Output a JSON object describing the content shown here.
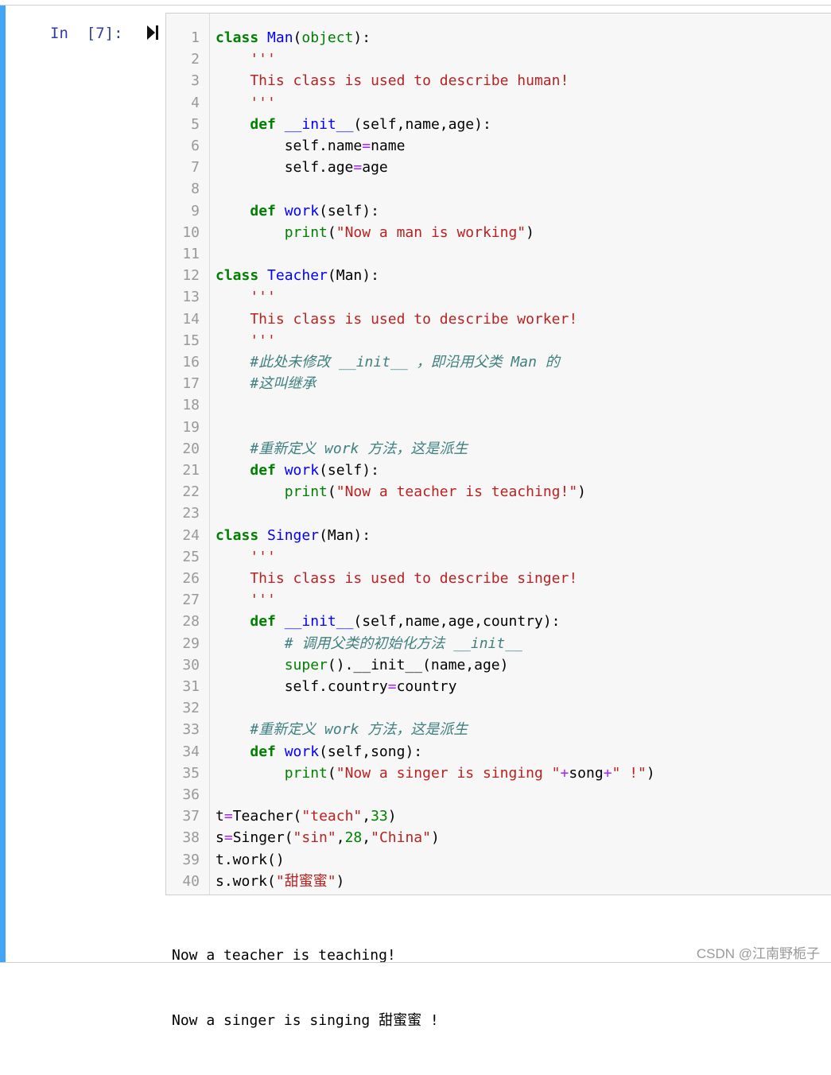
{
  "cell": {
    "prompt": "In  [7]:",
    "run_icon": "run-cell-icon",
    "accent_color": "#42a5f5"
  },
  "code": {
    "line_numbers": [
      "1",
      "2",
      "3",
      "4",
      "5",
      "6",
      "7",
      "8",
      "9",
      "10",
      "11",
      "12",
      "13",
      "14",
      "15",
      "16",
      "17",
      "18",
      "19",
      "20",
      "21",
      "22",
      "23",
      "24",
      "25",
      "26",
      "27",
      "28",
      "29",
      "30",
      "31",
      "32",
      "33",
      "34",
      "35",
      "36",
      "37",
      "38",
      "39",
      "40"
    ],
    "lines": [
      [
        [
          "kw",
          "class"
        ],
        [
          "",
          ""
        ],
        [
          "",
          ""
        ]
      ],
      [],
      [],
      [],
      [],
      [],
      [],
      [],
      [],
      [],
      [],
      [],
      [],
      [],
      [],
      [],
      [],
      [],
      [],
      [],
      [],
      [],
      [],
      [],
      [],
      [],
      [],
      [],
      [],
      [],
      [],
      [],
      [],
      [],
      [],
      [],
      [],
      [],
      [],
      []
    ],
    "source": [
      [
        [
          "kw",
          "class"
        ],
        [
          "t",
          " "
        ],
        [
          "def-name",
          "Man"
        ],
        [
          "t",
          "("
        ],
        [
          "builtin",
          "object"
        ],
        [
          "t",
          "):"
        ]
      ],
      [
        [
          "doc",
          "    '''"
        ]
      ],
      [
        [
          "doc",
          "    This class is used to describe human!"
        ]
      ],
      [
        [
          "doc",
          "    '''"
        ]
      ],
      [
        [
          "t",
          "    "
        ],
        [
          "kw",
          "def"
        ],
        [
          "t",
          " "
        ],
        [
          "def-name",
          "__init__"
        ],
        [
          "t",
          "(self,name,age):"
        ]
      ],
      [
        [
          "t",
          "        self.name"
        ],
        [
          "op",
          "="
        ],
        [
          "t",
          "name"
        ]
      ],
      [
        [
          "t",
          "        self.age"
        ],
        [
          "op",
          "="
        ],
        [
          "t",
          "age"
        ]
      ],
      [
        [
          "t",
          ""
        ]
      ],
      [
        [
          "t",
          "    "
        ],
        [
          "kw",
          "def"
        ],
        [
          "t",
          " "
        ],
        [
          "def-name",
          "work"
        ],
        [
          "t",
          "(self):"
        ]
      ],
      [
        [
          "t",
          "        "
        ],
        [
          "builtin",
          "print"
        ],
        [
          "t",
          "("
        ],
        [
          "str",
          "\"Now a man is working\""
        ],
        [
          "t",
          ")"
        ]
      ],
      [
        [
          "t",
          ""
        ]
      ],
      [
        [
          "kw",
          "class"
        ],
        [
          "t",
          " "
        ],
        [
          "def-name",
          "Teacher"
        ],
        [
          "t",
          "(Man):"
        ]
      ],
      [
        [
          "doc",
          "    '''"
        ]
      ],
      [
        [
          "doc",
          "    This class is used to describe worker!"
        ]
      ],
      [
        [
          "doc",
          "    '''"
        ]
      ],
      [
        [
          "t",
          "    "
        ],
        [
          "cm",
          "#此处未修改 __init__ ，即沿用父类 Man 的"
        ]
      ],
      [
        [
          "t",
          "    "
        ],
        [
          "cm",
          "#这叫继承"
        ]
      ],
      [
        [
          "t",
          ""
        ]
      ],
      [
        [
          "t",
          ""
        ]
      ],
      [
        [
          "t",
          "    "
        ],
        [
          "cm",
          "#重新定义 work 方法，这是派生"
        ]
      ],
      [
        [
          "t",
          "    "
        ],
        [
          "kw",
          "def"
        ],
        [
          "t",
          " "
        ],
        [
          "def-name",
          "work"
        ],
        [
          "t",
          "(self):"
        ]
      ],
      [
        [
          "t",
          "        "
        ],
        [
          "builtin",
          "print"
        ],
        [
          "t",
          "("
        ],
        [
          "str",
          "\"Now a teacher is teaching!\""
        ],
        [
          "t",
          ")"
        ]
      ],
      [
        [
          "t",
          ""
        ]
      ],
      [
        [
          "kw",
          "class"
        ],
        [
          "t",
          " "
        ],
        [
          "def-name",
          "Singer"
        ],
        [
          "t",
          "(Man):"
        ]
      ],
      [
        [
          "doc",
          "    '''"
        ]
      ],
      [
        [
          "doc",
          "    This class is used to describe singer!"
        ]
      ],
      [
        [
          "doc",
          "    '''"
        ]
      ],
      [
        [
          "t",
          "    "
        ],
        [
          "kw",
          "def"
        ],
        [
          "t",
          " "
        ],
        [
          "def-name",
          "__init__"
        ],
        [
          "t",
          "(self,name,age,country):"
        ]
      ],
      [
        [
          "t",
          "        "
        ],
        [
          "cm",
          "# 调用父类的初始化方法 __init__"
        ]
      ],
      [
        [
          "t",
          "        "
        ],
        [
          "builtin",
          "super"
        ],
        [
          "t",
          "().__init__(name,age)"
        ]
      ],
      [
        [
          "t",
          "        self.country"
        ],
        [
          "op",
          "="
        ],
        [
          "t",
          "country"
        ]
      ],
      [
        [
          "t",
          ""
        ]
      ],
      [
        [
          "t",
          "    "
        ],
        [
          "cm",
          "#重新定义 work 方法，这是派生"
        ]
      ],
      [
        [
          "t",
          "    "
        ],
        [
          "kw",
          "def"
        ],
        [
          "t",
          " "
        ],
        [
          "def-name",
          "work"
        ],
        [
          "t",
          "(self,song):"
        ]
      ],
      [
        [
          "t",
          "        "
        ],
        [
          "builtin",
          "print"
        ],
        [
          "t",
          "("
        ],
        [
          "str",
          "\"Now a singer is singing \""
        ],
        [
          "op",
          "+"
        ],
        [
          "t",
          "song"
        ],
        [
          "op",
          "+"
        ],
        [
          "str",
          "\" !\""
        ],
        [
          "t",
          ")"
        ]
      ],
      [
        [
          "t",
          ""
        ]
      ],
      [
        [
          "t",
          "t"
        ],
        [
          "op",
          "="
        ],
        [
          "t",
          "Teacher("
        ],
        [
          "str",
          "\"teach\""
        ],
        [
          "t",
          ","
        ],
        [
          "num",
          "33"
        ],
        [
          "t",
          ")"
        ]
      ],
      [
        [
          "t",
          "s"
        ],
        [
          "op",
          "="
        ],
        [
          "t",
          "Singer("
        ],
        [
          "str",
          "\"sin\""
        ],
        [
          "t",
          ","
        ],
        [
          "num",
          "28"
        ],
        [
          "t",
          ","
        ],
        [
          "str",
          "\"China\""
        ],
        [
          "t",
          ")"
        ]
      ],
      [
        [
          "t",
          "t.work()"
        ]
      ],
      [
        [
          "t",
          "s.work("
        ],
        [
          "str",
          "\"甜蜜蜜\""
        ],
        [
          "t",
          ")"
        ]
      ]
    ]
  },
  "output": {
    "lines": [
      "Now a teacher is teaching!",
      "Now a singer is singing 甜蜜蜜 !"
    ]
  },
  "watermark": "CSDN @江南野栀子"
}
